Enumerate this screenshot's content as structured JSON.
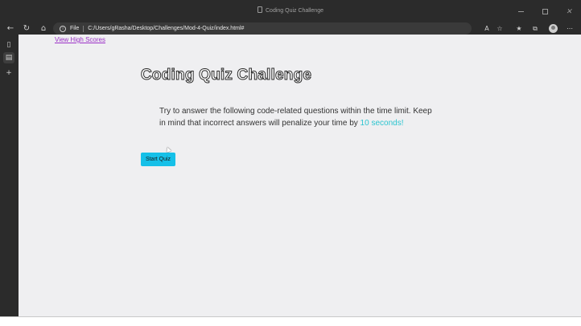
{
  "browser": {
    "tab_title": "Coding Quiz Challenge",
    "address": {
      "scheme_label": "File",
      "url": "C:/Users/gRasha/Desktop/Challenges/Mod-4-Quiz/index.html#"
    },
    "icons": {
      "back": "back-arrow-icon",
      "refresh": "refresh-icon",
      "home": "home-icon",
      "info": "info-icon",
      "read_aloud": "read-aloud-icon",
      "favorite_add": "add-favorite-icon",
      "favorites": "favorites-icon",
      "collections": "collections-icon",
      "more": "more-icon"
    },
    "colors": {
      "chrome": "#2b2b2b",
      "address_bg": "#3a3a3a"
    }
  },
  "page": {
    "high_scores_link": "View High Scores",
    "title": "Coding Quiz Challenge",
    "intro": {
      "text": "Try to answer the following code-related questions within the time limit. Keep in mind that incorrect answers will penalize your time by ",
      "highlight": "10 seconds!"
    },
    "start_button": "Start Quiz",
    "colors": {
      "background": "#efeff1",
      "link": "#9b30c7",
      "accent": "#2cc5d0",
      "button": "#16c0e8"
    }
  }
}
